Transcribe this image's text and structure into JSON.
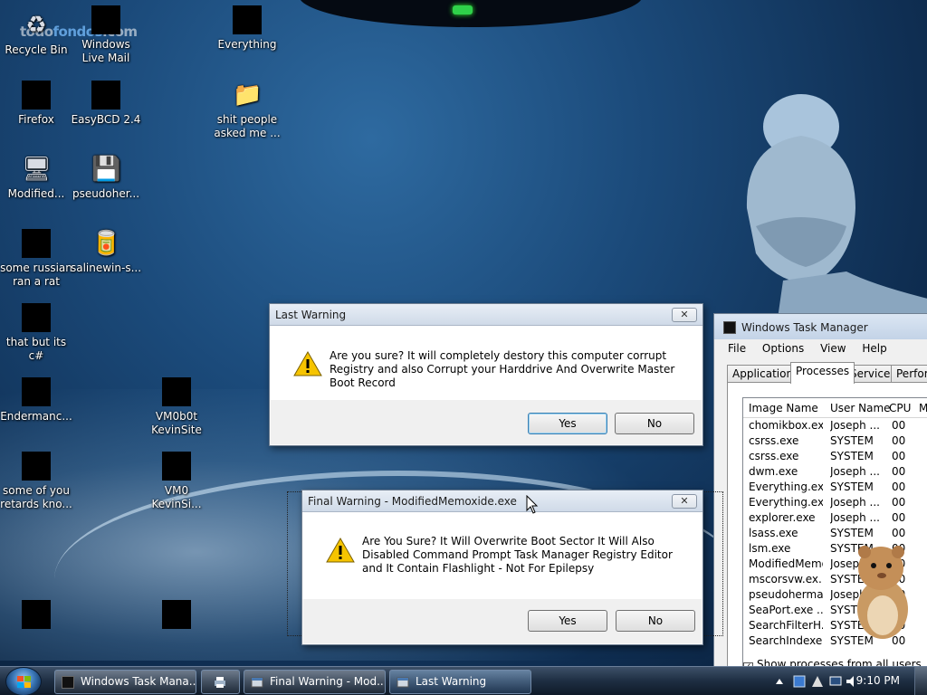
{
  "watermark": {
    "part1": "todo",
    "part2": "fondos",
    "part3": ".com"
  },
  "desktop_icons": [
    {
      "label": "Recycle Bin"
    },
    {
      "label": "Windows Live Mail"
    },
    {
      "label": "Everything"
    },
    {
      "label": "Firefox"
    },
    {
      "label": "EasyBCD 2.4"
    },
    {
      "label": "shit people asked me ..."
    },
    {
      "label": "Modified..."
    },
    {
      "label": "pseudoher..."
    },
    {
      "label": "some russian ran a rat"
    },
    {
      "label": "salinewin-s..."
    },
    {
      "label": "that but its c#"
    },
    {
      "label": "Endermanc..."
    },
    {
      "label": "VM0b0t KevinSite"
    },
    {
      "label": "some of you retards kno..."
    },
    {
      "label": "VM0 KevinSi..."
    }
  ],
  "dialog1": {
    "title": "Last Warning",
    "close": "✕",
    "message": "Are you sure? It will completely destory this computer corrupt Registry and also Corrupt your Harddrive And Overwrite Master Boot Record",
    "yes": "Yes",
    "no": "No"
  },
  "dialog2": {
    "title": "Final Warning - ModifiedMemoxide.exe",
    "close": "✕",
    "message": "Are You Sure? It Will Overwrite Boot Sector It Will Also Disabled Command Prompt Task Manager Registry Editor and It Contain Flashlight - Not For Epilepsy",
    "yes": "Yes",
    "no": "No"
  },
  "task_manager": {
    "title": "Windows Task Manager",
    "menu": [
      "File",
      "Options",
      "View",
      "Help"
    ],
    "tabs": [
      "Applications",
      "Processes",
      "Services",
      "Perform"
    ],
    "active_tab": "Processes",
    "columns": [
      "Image Name",
      "User Name",
      "CPU",
      "M"
    ],
    "rows": [
      [
        "chomikbox.ex...",
        "Joseph ...",
        "00"
      ],
      [
        "csrss.exe",
        "SYSTEM",
        "00"
      ],
      [
        "csrss.exe",
        "SYSTEM",
        "00"
      ],
      [
        "dwm.exe",
        "Joseph ...",
        "00"
      ],
      [
        "Everything.exe",
        "SYSTEM",
        "00"
      ],
      [
        "Everything.exe",
        "Joseph ...",
        "00"
      ],
      [
        "explorer.exe",
        "Joseph ...",
        "00"
      ],
      [
        "lsass.exe",
        "SYSTEM",
        "00"
      ],
      [
        "lsm.exe",
        "SYSTEM",
        "00"
      ],
      [
        "ModifiedMemo...",
        "Joseph ...",
        "00"
      ],
      [
        "mscorsvw.ex...",
        "SYSTEM",
        "00"
      ],
      [
        "pseudoherma...",
        "Joseph ...",
        "00"
      ],
      [
        "SeaPort.exe ...",
        "SYSTEM",
        "00"
      ],
      [
        "SearchFilterH...",
        "SYSTEM",
        "00"
      ],
      [
        "SearchIndexe...",
        "SYSTEM",
        "00"
      ]
    ],
    "show_all": "Show processes from all users"
  },
  "taskbar": {
    "buttons": [
      {
        "label": "Windows Task Mana...",
        "icon": "task-manager-icon"
      },
      {
        "label": "",
        "icon": "printer-icon"
      },
      {
        "label": "Final Warning - Mod...",
        "icon": "program-icon"
      },
      {
        "label": "Last Warning",
        "icon": "program-icon"
      }
    ],
    "clock": "9:10 PM"
  }
}
